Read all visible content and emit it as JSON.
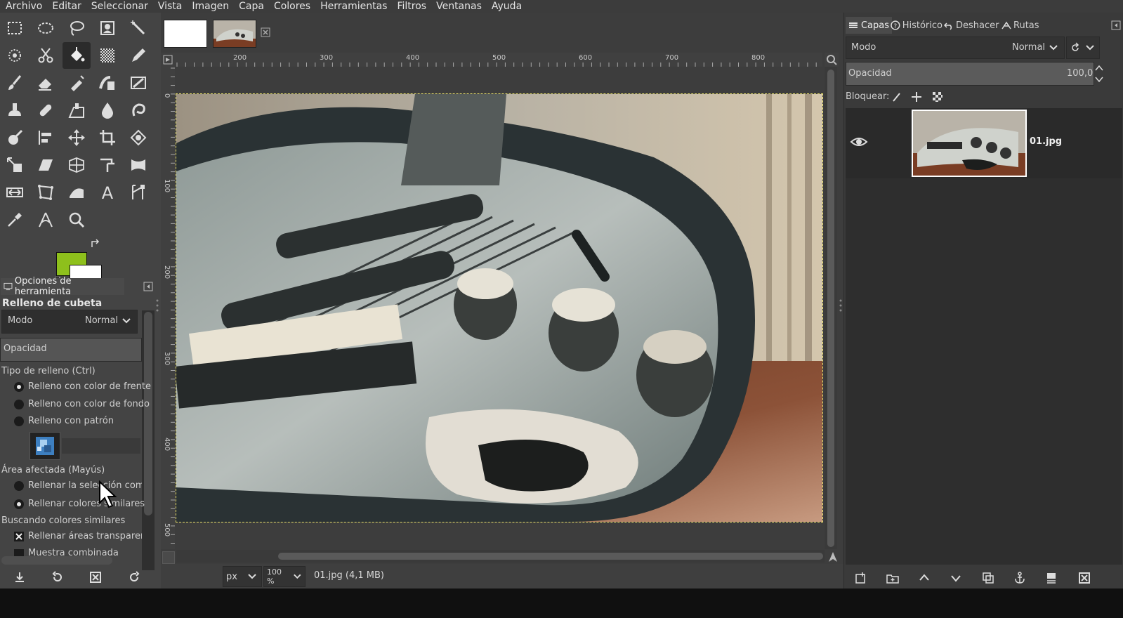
{
  "menubar": {
    "items": [
      "Archivo",
      "Editar",
      "Seleccionar",
      "Vista",
      "Imagen",
      "Capa",
      "Colores",
      "Herramientas",
      "Filtros",
      "Ventanas",
      "Ayuda"
    ]
  },
  "colors": {
    "foreground": "#8ec01c",
    "background": "#ffffff"
  },
  "tool_options": {
    "tab_label": "Opciones de herramienta",
    "title": "Relleno de cubeta",
    "mode_label": "Modo",
    "mode_value": "Normal",
    "opacity_label": "Opacidad",
    "fill_type_label": "Tipo de relleno  (Ctrl)",
    "fill_fg": "Relleno con color de frente",
    "fill_bg": "Relleno con color de fondo",
    "fill_pattern": "Relleno con patrón",
    "affected_area_label": "Área afectada  (Mayús)",
    "fill_selection": "Rellenar la selección comple",
    "fill_similar": "Rellenar colores similares",
    "finding_label": "Buscando colores similares",
    "fill_transparent": "Rellenar áreas transparente",
    "sample_merged": "Muestra combinada"
  },
  "ruler": {
    "h_ticks": [
      "200",
      "300",
      "400",
      "500",
      "600",
      "700",
      "800"
    ],
    "v_ticks": [
      "0",
      "100",
      "200",
      "300",
      "400",
      "500"
    ]
  },
  "status": {
    "unit": "px",
    "zoom": "100 %",
    "file_info": "01.jpg (4,1 MB)"
  },
  "layers_dock": {
    "tabs": [
      "Capas",
      "Histórico",
      "Deshacer",
      "Rutas"
    ],
    "mode_label": "Modo",
    "mode_value": "Normal",
    "opacity_label": "Opacidad",
    "opacity_value": "100,0",
    "lock_label": "Bloquear:",
    "layer_name": "01.jpg"
  }
}
